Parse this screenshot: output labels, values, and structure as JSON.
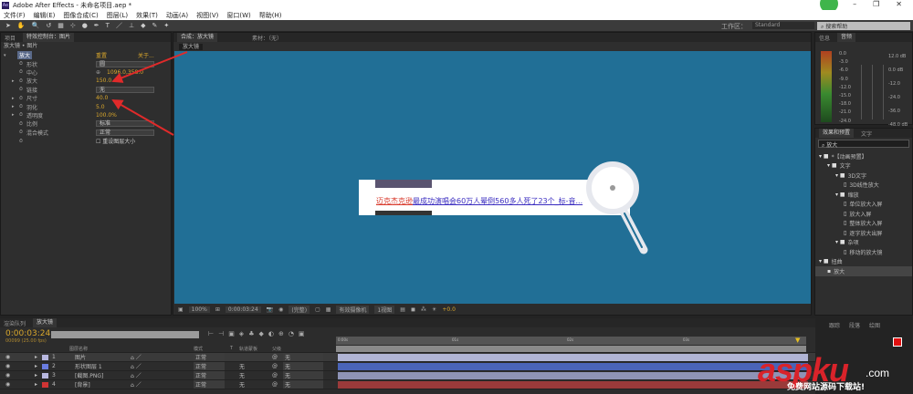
{
  "app": {
    "title": "Adobe After Effects - 未命名项目.aep *",
    "logo": "Ae"
  },
  "window_controls": {
    "minimize": "–",
    "maximize": "❐",
    "close": "✕"
  },
  "menu": [
    "文件(F)",
    "编辑(E)",
    "图像合成(C)",
    "图层(L)",
    "效果(T)",
    "动画(A)",
    "视图(V)",
    "窗口(W)",
    "帮助(H)"
  ],
  "toolbar": {
    "tools": [
      "selection-tool",
      "hand-tool",
      "zoom-tool",
      "rotate-tool",
      "camera-tool",
      "pan-behind-tool",
      "mask-tool",
      "pen-tool",
      "text-tool",
      "brush-tool",
      "clone-tool",
      "eraser-tool",
      "roto-tool",
      "puppet-tool"
    ],
    "workspace_label": "工作区：",
    "workspace_value": "Standard",
    "help_search": "搜索帮助"
  },
  "left_panel": {
    "tabs": [
      "项目",
      "特效控制台：图片"
    ],
    "breadcrumb": "放大镜 • 图片",
    "effect": {
      "name": "放大",
      "reset": "重置",
      "about": "关于..."
    },
    "rows": [
      {
        "name": "形状",
        "value": "圆",
        "type": "dropdown"
      },
      {
        "name": "中心",
        "value": "1096.0,358.0",
        "type": "point"
      },
      {
        "name": "放大",
        "value": "150.0",
        "type": "value",
        "twirl": true
      },
      {
        "name": "链接",
        "value": "无",
        "type": "dropdown"
      },
      {
        "name": "尺寸",
        "value": "40.0",
        "type": "value",
        "twirl": true
      },
      {
        "name": "羽化",
        "value": "5.0",
        "type": "value",
        "twirl": true
      },
      {
        "name": "透明度",
        "value": "100.0%",
        "type": "value",
        "twirl": true
      },
      {
        "name": "比例",
        "value": "标准",
        "type": "dropdown"
      },
      {
        "name": "混合模式",
        "value": "正常",
        "type": "dropdown"
      },
      {
        "name": "",
        "value": "重设图层大小",
        "type": "checkbox"
      }
    ]
  },
  "viewer": {
    "tabs": [
      "合成：放大镜",
      "素材：（无）"
    ],
    "comp_tab": "放大镜",
    "web_text_red": "迈克杰克逊",
    "web_text_link": "最成功演唱会60万人晕倒560多人死了23个_标-音...",
    "bottom": {
      "zoom": "100%",
      "timecode": "0:00:03:24",
      "resolution": "(完整)",
      "camera": "有效摄像机",
      "views": "1视图",
      "exposure": "+0.0"
    }
  },
  "audio_panel": {
    "tabs": [
      "信息",
      "音频"
    ],
    "left_scale": [
      "0.0",
      "-3.0",
      "-6.0",
      "-9.0",
      "-12.0",
      "-15.0",
      "-18.0",
      "-21.0",
      "-24.0"
    ],
    "right_scale": [
      "12.0 dB",
      "0.0 dB",
      "-12.0",
      "-24.0",
      "-36.0",
      "-48.0 dB"
    ]
  },
  "effects_panel": {
    "tabs": [
      "效果和预置",
      "文字"
    ],
    "search": "放大",
    "tree": [
      {
        "label": "*【动画预置】",
        "level": 0,
        "kind": "folder"
      },
      {
        "label": "文字",
        "level": 1,
        "kind": "folder"
      },
      {
        "label": "3D文字",
        "level": 2,
        "kind": "folder"
      },
      {
        "label": "3D线性放大",
        "level": 3,
        "kind": "preset"
      },
      {
        "label": "缩放",
        "level": 2,
        "kind": "folder"
      },
      {
        "label": "单位放大入屏",
        "level": 3,
        "kind": "preset"
      },
      {
        "label": "放大入屏",
        "level": 3,
        "kind": "preset"
      },
      {
        "label": "整体放大入屏",
        "level": 3,
        "kind": "preset"
      },
      {
        "label": "逐字放大出屏",
        "level": 3,
        "kind": "preset"
      },
      {
        "label": "杂项",
        "level": 2,
        "kind": "folder"
      },
      {
        "label": "移动的放大镜",
        "level": 3,
        "kind": "preset"
      },
      {
        "label": "扭曲",
        "level": 0,
        "kind": "folder"
      },
      {
        "label": "放大",
        "level": 1,
        "kind": "effect",
        "selected": true
      }
    ]
  },
  "timeline": {
    "tabs": [
      "渲染队列",
      "放大镜"
    ],
    "timecode": "0:00:03:24",
    "frame_info": "00099 (25.00 fps)",
    "columns": [
      "图层名称",
      "模式",
      "T",
      "轨道蒙板",
      "父级"
    ],
    "ruler": [
      "0:00s",
      "01s",
      "02s",
      "03s"
    ],
    "layers": [
      {
        "index": "1",
        "name": "图片",
        "mode": "正常",
        "matte": "",
        "parent": "无",
        "color": "#b8b8e0",
        "bar": "#b0b4d4"
      },
      {
        "index": "2",
        "name": "形状图层 1",
        "mode": "正常",
        "matte": "无",
        "parent": "无",
        "color": "#6a7ce0",
        "bar": "#4a64b8"
      },
      {
        "index": "3",
        "name": "[截图.PNG]",
        "mode": "正常",
        "matte": "无",
        "parent": "无",
        "color": "#b8b8e0",
        "bar": "#8e93b6"
      },
      {
        "index": "4",
        "name": "[背景]",
        "mode": "正常",
        "matte": "无",
        "parent": "无",
        "color": "#d03434",
        "bar": "#9a3a3a"
      }
    ]
  },
  "bottom_right_tabs": [
    "跟踪",
    "段落",
    "绘图"
  ],
  "watermark": {
    "main": "aspku",
    ".com": ".com",
    "sub": "免费网站源码下载站!"
  },
  "colors": {
    "canvas": "#216f96",
    "accent_value": "#d9a72c",
    "arrow": "#e02a2a"
  }
}
